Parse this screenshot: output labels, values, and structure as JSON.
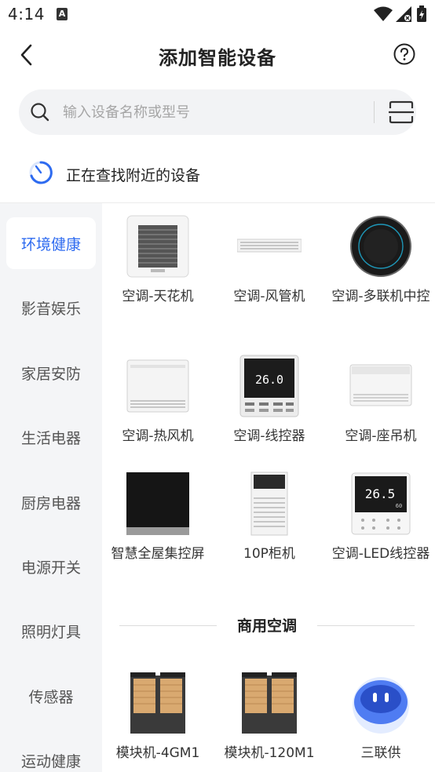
{
  "status_bar": {
    "time": "4:14",
    "notification_letter": "A"
  },
  "header": {
    "title": "添加智能设备"
  },
  "search": {
    "placeholder": "输入设备名称或型号",
    "value": ""
  },
  "scan": {
    "status_text": "正在查找附近的设备"
  },
  "sidebar": {
    "items": [
      {
        "label": "环境健康",
        "active": true
      },
      {
        "label": "影音娱乐",
        "active": false
      },
      {
        "label": "家居安防",
        "active": false
      },
      {
        "label": "生活电器",
        "active": false
      },
      {
        "label": "厨房电器",
        "active": false
      },
      {
        "label": "电源开关",
        "active": false
      },
      {
        "label": "照明灯具",
        "active": false
      },
      {
        "label": "传感器",
        "active": false
      },
      {
        "label": "运动健康",
        "active": false
      }
    ]
  },
  "devices": [
    {
      "label": "空调-天花机",
      "icon": "ceiling-cassette-ac-icon"
    },
    {
      "label": "空调-风管机",
      "icon": "duct-ac-icon"
    },
    {
      "label": "空调-多联机中控",
      "icon": "vrf-central-controller-icon"
    },
    {
      "label": "空调-热风机",
      "icon": "heater-unit-icon"
    },
    {
      "label": "空调-线控器",
      "icon": "wired-controller-icon"
    },
    {
      "label": "空调-座吊机",
      "icon": "floor-ceiling-ac-icon"
    },
    {
      "label": "智慧全屋集控屏",
      "icon": "smart-control-screen-icon"
    },
    {
      "label": "10P柜机",
      "icon": "cabinet-ac-icon"
    },
    {
      "label": "空调-LED线控器",
      "icon": "led-wired-controller-icon"
    }
  ],
  "commercial_section": {
    "title": "商用空调",
    "devices": [
      {
        "label": "模块机-4GM1",
        "icon": "modular-unit-icon"
      },
      {
        "label": "模块机-120M1",
        "icon": "modular-unit-icon"
      },
      {
        "label": "三联供",
        "icon": "robot-assistant-icon"
      }
    ]
  },
  "device_screens": {
    "controller_temp": "26.0",
    "led_temp": "26.5",
    "led_sub": "60"
  },
  "colors": {
    "accent": "#2e6bf0",
    "sidebar_bg": "#f4f5f7",
    "search_bg": "#f2f3f5"
  }
}
